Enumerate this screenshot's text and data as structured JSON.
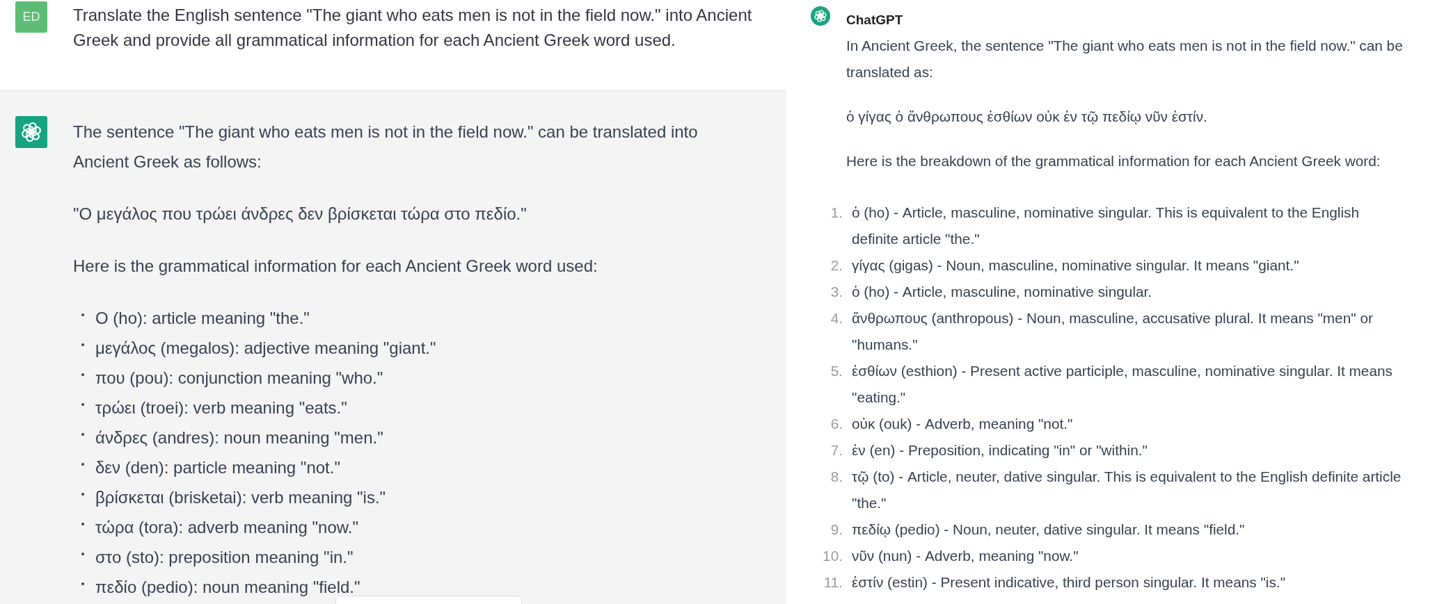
{
  "left_panel": {
    "user_message": {
      "initials": "ED",
      "text": "Translate the English sentence \"The giant who eats men is not in the field now.\" into Ancient Greek and provide all grammatical information for each Ancient Greek word used."
    },
    "reply": {
      "paragraphs": [
        "The sentence \"The giant who eats men is not in the field now.\" can be translated into Ancient Greek as follows:",
        "\"Ο μεγάλος που τρώει άνδρες δεν βρίσκεται τώρα στο πεδίο.\"",
        "Here is the grammatical information for each Ancient Greek word used:"
      ],
      "bullets": [
        "Ο (ho): article meaning \"the.\"",
        "μεγάλος (megalos): adjective meaning \"giant.\"",
        "που (pou): conjunction meaning \"who.\"",
        "τρώει (troei): verb meaning \"eats.\"",
        "άνδρες (andres): noun meaning \"men.\"",
        "δεν (den): particle meaning \"not.\"",
        "βρίσκεται (brisketai): verb meaning \"is.\"",
        "τώρα (tora): adverb meaning \"now.\"",
        "στο (sto): preposition meaning \"in.\"",
        "πεδίο (pedio): noun meaning \"field.\""
      ]
    }
  },
  "right_panel": {
    "author": "ChatGPT",
    "paragraphs": [
      "In Ancient Greek, the sentence \"The giant who eats men is not in the field now.\" can be translated as:",
      "ὁ γίγας ὁ ἄνθρωπους ἐσθίων οὐκ ἐν τῷ πεδίῳ νῦν ἐστίν.",
      "Here is the breakdown of the grammatical information for each Ancient Greek word:"
    ],
    "items": [
      {
        "number": "1.",
        "text": "ὁ (ho) - Article, masculine, nominative singular. This is equivalent to the English definite article \"the.\""
      },
      {
        "number": "2.",
        "text": "γίγας (gigas) - Noun, masculine, nominative singular. It means \"giant.\""
      },
      {
        "number": "3.",
        "text": "ὁ (ho) - Article, masculine, nominative singular."
      },
      {
        "number": "4.",
        "text": "ἄνθρωπους (anthropous) - Noun, masculine, accusative plural. It means \"men\" or \"humans.\""
      },
      {
        "number": "5.",
        "text": "ἐσθίων (esthion) - Present active participle, masculine, nominative singular. It means \"eating.\""
      },
      {
        "number": "6.",
        "text": "οὐκ (ouk) - Adverb, meaning \"not.\""
      },
      {
        "number": "7.",
        "text": "ἐν (en) - Preposition, indicating \"in\" or \"within.\""
      },
      {
        "number": "8.",
        "text": "τῷ (to) - Article, neuter, dative singular. This is equivalent to the English definite article \"the.\""
      },
      {
        "number": "9.",
        "text": "πεδίῳ (pedio) - Noun, neuter, dative singular. It means \"field.\""
      },
      {
        "number": "10.",
        "text": "νῦν (nun) - Adverb, meaning \"now.\""
      },
      {
        "number": "11.",
        "text": "ἐστίν (estin) - Present indicative, third person singular. It means \"is.\""
      }
    ]
  }
}
